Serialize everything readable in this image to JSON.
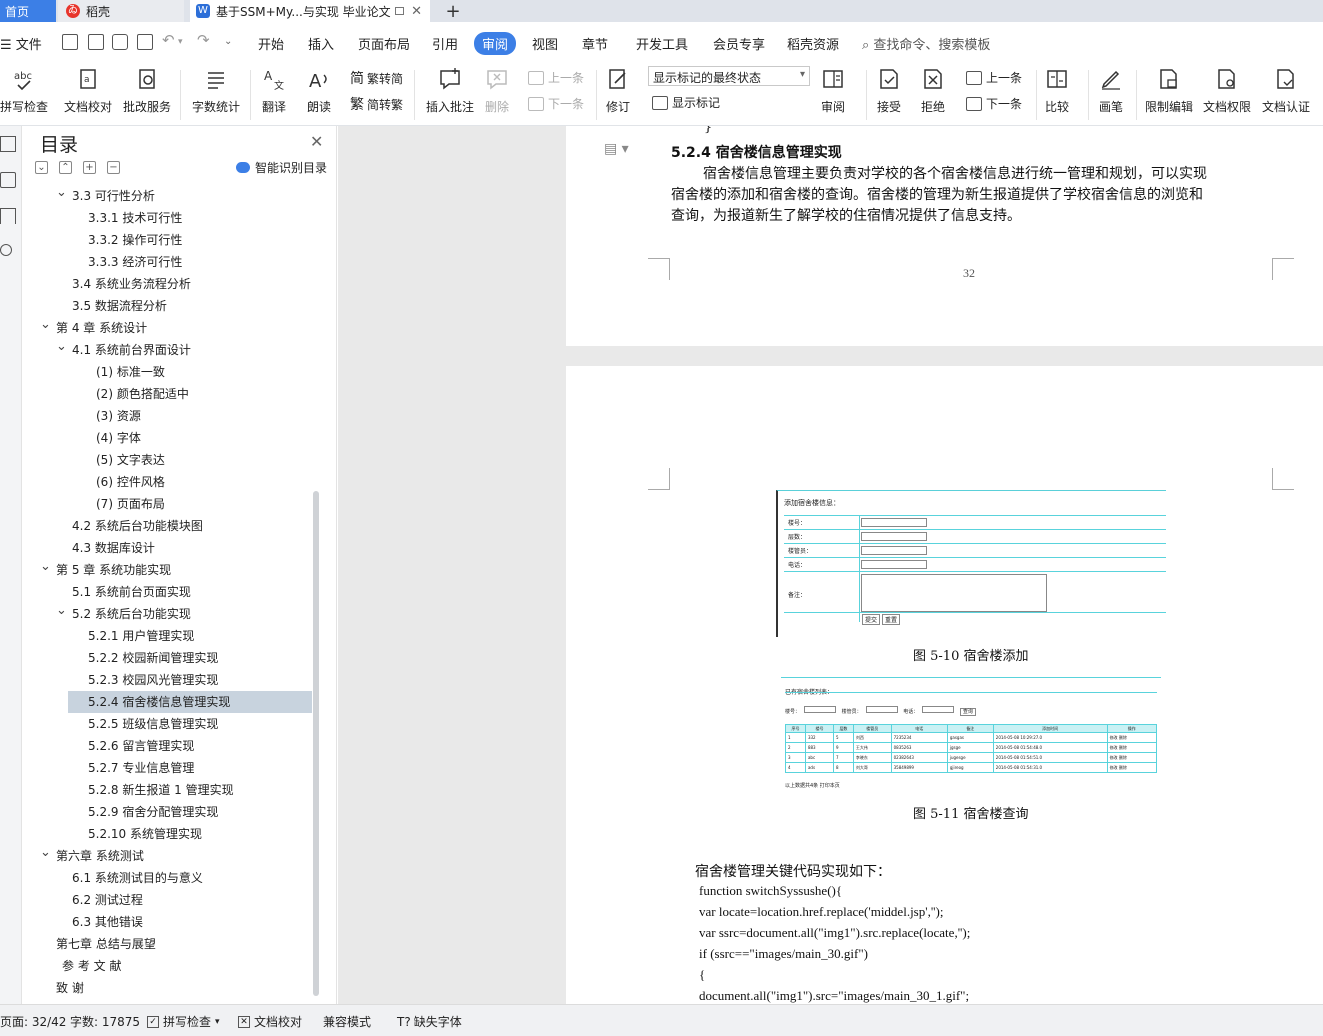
{
  "tabs": {
    "home": "首页",
    "daoke": "稻壳",
    "doc": "基于SSM+My...与实现 毕业论文",
    "new_tab": "+"
  },
  "menu": {
    "file": "文件",
    "items": [
      "开始",
      "插入",
      "页面布局",
      "引用",
      "审阅",
      "视图",
      "章节",
      "开发工具",
      "会员专享",
      "稻壳资源"
    ],
    "active": "审阅",
    "search_placeholder": "查找命令、搜索模板"
  },
  "toolbar": {
    "spell_check": "拼写检查",
    "doc_proof": "文档校对",
    "correction": "批改服务",
    "word_count": "字数统计",
    "translate": "翻译",
    "read_aloud": "朗读",
    "to_traditional": "繁转简",
    "to_simplified": "简转繁",
    "insert_comment": "插入批注",
    "delete": "删除",
    "prev_comment": "上一条",
    "next_comment": "下一条",
    "revise": "修订",
    "markup_state": "显示标记的最终状态",
    "show_markup": "显示标记",
    "review": "审阅",
    "accept": "接受",
    "reject": "拒绝",
    "prev_change": "上一条",
    "next_change": "下一条",
    "compare": "比较",
    "ink": "画笔",
    "restrict_edit": "限制编辑",
    "doc_permission": "文档权限",
    "doc_certify": "文档认证"
  },
  "toc": {
    "title": "目录",
    "smart": "智能识别目录",
    "items": [
      {
        "label": "3.3  可行性分析",
        "level": 1,
        "arrow": "expanded"
      },
      {
        "label": "3.3.1  技术可行性",
        "level": 3
      },
      {
        "label": "3.3.2  操作可行性",
        "level": 3
      },
      {
        "label": "3.3.3  经济可行性",
        "level": 3
      },
      {
        "label": "3.4 系统业务流程分析",
        "level": 2
      },
      {
        "label": "3.5 数据流程分析",
        "level": 2
      },
      {
        "label": "第 4 章    系统设计",
        "level": 0,
        "arrow": "expanded"
      },
      {
        "label": "4.1  系统前台界面设计",
        "level": 1,
        "arrow": "expanded"
      },
      {
        "label": "(1)  标准一致",
        "level": 4
      },
      {
        "label": "(2)  颜色搭配适中",
        "level": 4
      },
      {
        "label": "(3)  资源",
        "level": 4
      },
      {
        "label": "(4)  字体",
        "level": 4
      },
      {
        "label": "(5)  文字表达",
        "level": 4
      },
      {
        "label": "(6)  控件风格",
        "level": 4
      },
      {
        "label": "(7)  页面布局",
        "level": 4
      },
      {
        "label": "4.2  系统后台功能模块图",
        "level": 2
      },
      {
        "label": "4.3 数据库设计",
        "level": 2
      },
      {
        "label": "第 5 章  系统功能实现",
        "level": 0,
        "arrow": "expanded"
      },
      {
        "label": "5.1  系统前台页面实现",
        "level": 2
      },
      {
        "label": "5.2 系统后台功能实现",
        "level": 1,
        "arrow": "expanded"
      },
      {
        "label": "5.2.1 用户管理实现",
        "level": 3
      },
      {
        "label": "5.2.2  校园新闻管理实现",
        "level": 3
      },
      {
        "label": "5.2.3  校园风光管理实现",
        "level": 3
      },
      {
        "label": "5.2.4    宿舍楼信息管理实现",
        "level": 3,
        "selected": true
      },
      {
        "label": "5.2.5  班级信息管理实现",
        "level": 3
      },
      {
        "label": "5.2.6  留言管理实现",
        "level": 3
      },
      {
        "label": "5.2.7  专业信息管理",
        "level": 3
      },
      {
        "label": "5.2.8 新生报道 1 管理实现",
        "level": 3
      },
      {
        "label": "5.2.9  宿舍分配管理实现",
        "level": 3
      },
      {
        "label": "5.2.10  系统管理实现",
        "level": 3
      },
      {
        "label": "第六章  系统测试",
        "level": 0,
        "arrow": "expanded"
      },
      {
        "label": "6.1 系统测试目的与意义",
        "level": 2
      },
      {
        "label": "6.2 测试过程",
        "level": 2
      },
      {
        "label": "6.3 其他错误",
        "level": 2
      },
      {
        "label": "第七章  总结与展望",
        "level": 0
      },
      {
        "label": "参 考 文 献",
        "level": 0.4
      },
      {
        "label": "致  谢",
        "level": 0
      }
    ]
  },
  "document": {
    "brace": "}",
    "section_heading": "5.2.4    宿舍楼信息管理实现",
    "para_lines": [
      "宿舍楼信息管理主要负责对学校的各个宿舍楼信息进行统一管理和规划，可以实现",
      "宿舍楼的添加和宿舍楼的查询。宿舍楼的管理为新生报道提供了学校宿舍信息的浏览和",
      "查询，为报道新生了解学校的住宿情况提供了信息支持。"
    ],
    "page_number": "32",
    "fig1_caption": "图 5-10 宿舍楼添加",
    "fig2_caption": "图 5-11 宿舍楼查询",
    "code_intro": "宿舍楼管理关键代码实现如下：",
    "code_lines": [
      "function switchSyssushe(){",
      "var locate=location.href.replace('middel.jsp','');",
      "var ssrc=document.all(\"img1\").src.replace(locate,'');",
      "if (ssrc==\"images/main_30.gif\")",
      "{",
      "document.all(\"img1\").src=\"images/main_30_1.gif\";"
    ],
    "fig1": {
      "title": "添加宿舍楼信息：",
      "fields": [
        "楼号：",
        "层数：",
        "楼管员：",
        "电话：",
        "备注："
      ],
      "buttons": [
        "提交",
        "重置"
      ]
    },
    "fig2": {
      "title": "已有宿舍楼列表：",
      "search_labels": [
        "楼号：",
        "楼管员：",
        "电话："
      ],
      "search_button": "查询",
      "headers": [
        "序号",
        "楼号",
        "层数",
        "楼管员",
        "电话",
        "备注",
        "添加时间",
        "操作"
      ],
      "rows": [
        [
          "1",
          "332",
          "5",
          "刘西",
          "7235234",
          "gasgas",
          "2014-05-08 10:29:27.0",
          "修改 删除"
        ],
        [
          "2",
          "883",
          "9",
          "王大伟",
          "0835263",
          "jgsge",
          "2014-05-08 01:54:48.0",
          "修改 删除"
        ],
        [
          "3",
          "abc",
          "7",
          "李晓东",
          "02382643",
          "jugesge",
          "2014-05-08 01:54:51.0",
          "修改 删除"
        ],
        [
          "4",
          "ads",
          "8",
          "刘大哥",
          "35849899",
          "gjireog",
          "2014-05-08 01:54:31.0",
          "修改 删除"
        ]
      ],
      "footer": "以上数据共4条  打印本页"
    }
  },
  "status": {
    "page": "页面: 32/42",
    "words": "字数: 17875",
    "spell": "拼写检查",
    "proof": "文档校对",
    "compat": "兼容模式",
    "missing_font": "缺失字体"
  },
  "colors": {
    "accent": "#3c7fe6",
    "toc_selected": "#c8d3de",
    "figure_cyan": "#59d3dc"
  }
}
